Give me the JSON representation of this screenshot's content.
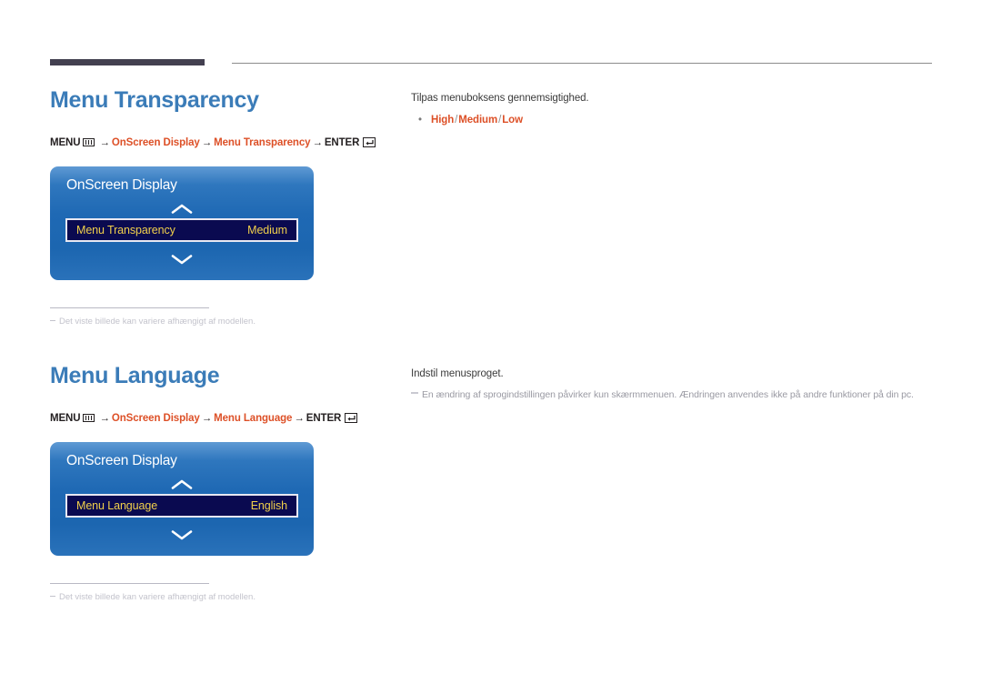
{
  "decoration": {
    "thick_bar": "#434050",
    "thin_rule": "#8c8c8c"
  },
  "theme": {
    "heading_color": "#3b7cb8",
    "link_color": "#dd5027",
    "osd_highlight_text": "#f1d04b",
    "osd_highlight_bg": "#0a0a50"
  },
  "sections": [
    {
      "heading": "Menu Transparency",
      "breadcrumb": {
        "menu_label": "MENU",
        "menu_icon": "menu-grid-icon",
        "arrow": "→",
        "path1": "OnScreen Display",
        "path2": "Menu Transparency",
        "enter_label": "ENTER",
        "enter_icon": "enter-return-icon"
      },
      "osd": {
        "title": "OnScreen Display",
        "chevron_up_icon": "chevron-up-icon",
        "chevron_down_icon": "chevron-down-icon",
        "row_label": "Menu Transparency",
        "row_value": "Medium"
      },
      "footnote": "Det viste billede kan variere afhængigt af modellen.",
      "description": "Tilpas menuboksens gennemsigtighed.",
      "options": {
        "bullet": "•",
        "o1": "High",
        "o2": "Medium",
        "o3": "Low",
        "sep": "/"
      },
      "note": ""
    },
    {
      "heading": "Menu Language",
      "breadcrumb": {
        "menu_label": "MENU",
        "menu_icon": "menu-grid-icon",
        "arrow": "→",
        "path1": "OnScreen Display",
        "path2": "Menu Language",
        "enter_label": "ENTER",
        "enter_icon": "enter-return-icon"
      },
      "osd": {
        "title": "OnScreen Display",
        "chevron_up_icon": "chevron-up-icon",
        "chevron_down_icon": "chevron-down-icon",
        "row_label": "Menu Language",
        "row_value": "English"
      },
      "footnote": "Det viste billede kan variere afhængigt af modellen.",
      "description": "Indstil menusproget.",
      "options": null,
      "note": "En ændring af sprogindstillingen påvirker kun skærmmenuen. Ændringen anvendes ikke på andre funktioner på din pc."
    }
  ]
}
